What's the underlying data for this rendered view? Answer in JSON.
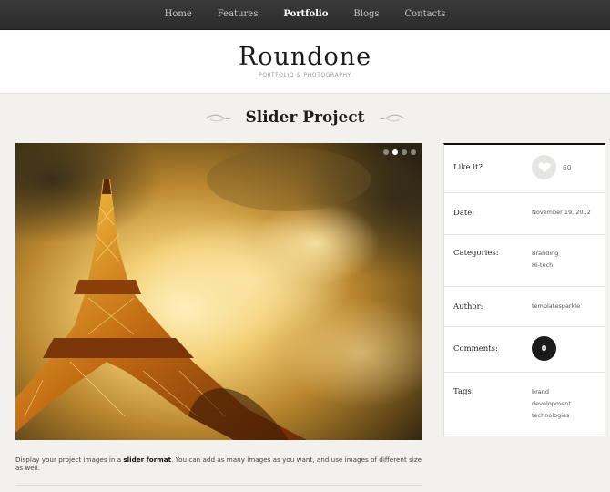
{
  "nav": {
    "items": [
      {
        "label": "Home",
        "active": false
      },
      {
        "label": "Features",
        "active": false
      },
      {
        "label": "Portfolio",
        "active": true
      },
      {
        "label": "Blogs",
        "active": false
      },
      {
        "label": "Contacts",
        "active": false
      }
    ]
  },
  "header": {
    "brand": "Roundone",
    "tagline": "PORTFOLIO & PHOTOGRAPHY"
  },
  "page": {
    "title": "Slider Project"
  },
  "slider": {
    "image": "eiffel-tower-photo",
    "dots": 4,
    "active_dot": 1
  },
  "description": {
    "before": "Display your project images in a ",
    "bold": "slider format",
    "after": ". You can add as many images as you want, and use images of different size as well."
  },
  "info": {
    "like_label": "Like it?",
    "like_count": "60",
    "date_label": "Date:",
    "date_value": "November 19, 2012",
    "categories_label": "Categories:",
    "categories": [
      "Branding",
      "Hi-tech"
    ],
    "author_label": "Author:",
    "author_value": "templatesparkle",
    "comments_label": "Comments:",
    "comments_count": "0",
    "tags_label": "Tags:",
    "tags": [
      "brand",
      "development",
      "technologies"
    ]
  },
  "colors": {
    "nav_bg": "#2f2f2f",
    "page_bg": "#f3f1ee",
    "panel_border_top": "#111111"
  }
}
